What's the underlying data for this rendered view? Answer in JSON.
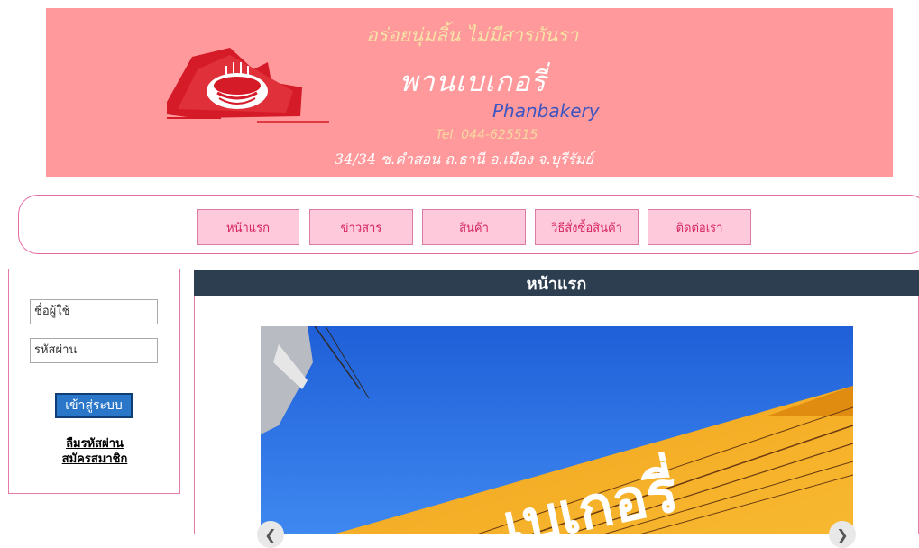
{
  "header": {
    "tagline": "อร่อยนุ่มลิ้น ไม่มีสารกันรา",
    "shop_name": "พานเบเกอรี่",
    "shop_name_en": "Phanbakery",
    "phone": "Tel. 044-625515",
    "address": "34/34 ซ.คำสอน ถ.ธานี อ.เมือง จ.บุรีรัมย์",
    "logo_icon": "cake-house-logo"
  },
  "nav": {
    "items": [
      {
        "label": "หน้าแรก"
      },
      {
        "label": "ข่าวสาร"
      },
      {
        "label": "สินค้า"
      },
      {
        "label": "วิธีสั่งซื้อสินค้า"
      },
      {
        "label": "ติดต่อเรา"
      }
    ]
  },
  "login": {
    "username_placeholder": "ชื่อผู้ใช้",
    "password_placeholder": "รหัสผ่าน",
    "login_button": "เข้าสู่ระบบ",
    "forgot_link": "ลืมรหัสผ่าน",
    "register_link": "สมัครสมาชิก"
  },
  "main": {
    "title": "หน้าแรก",
    "slide_sign_text": "เบเกอรี่"
  },
  "colors": {
    "banner": "#ff999b",
    "menu_button": "#ffc9dc",
    "title_bar": "#2c3e50",
    "login_button": "#2a77c9"
  }
}
